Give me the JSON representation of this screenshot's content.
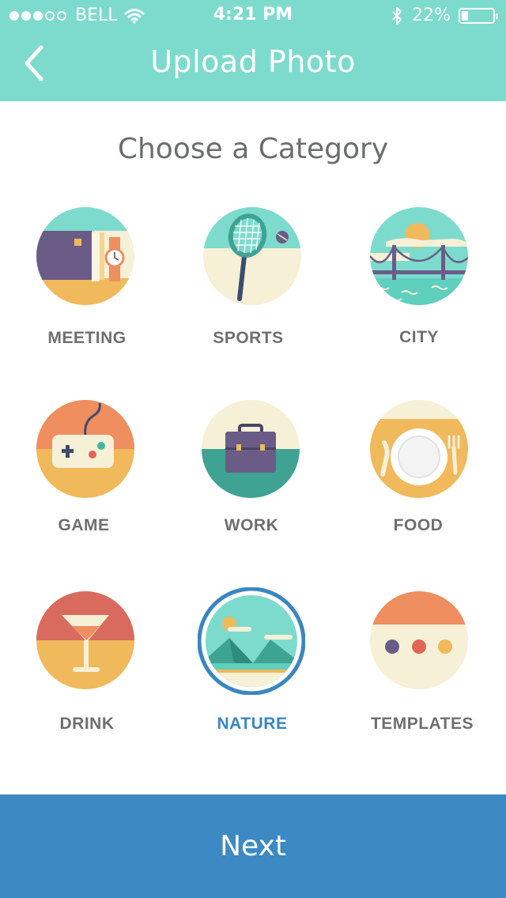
{
  "status_bar": {
    "carrier": "BELL",
    "time": "4:21 PM",
    "battery_percent": "22%",
    "battery_level": 0.22,
    "signal_bars": 3,
    "signal_total": 5,
    "icons": [
      "signal-dots-icon",
      "wifi-icon",
      "bluetooth-icon",
      "battery-icon"
    ]
  },
  "nav": {
    "title": "Upload Photo",
    "back_icon": "chevron-left-icon"
  },
  "heading": "Choose a Category",
  "categories": [
    {
      "label": "MEETING",
      "icon": "meeting-icon",
      "selected": false
    },
    {
      "label": "SPORTS",
      "icon": "tennis-racket-icon",
      "selected": false
    },
    {
      "label": "CITY",
      "icon": "bridge-icon",
      "selected": false
    },
    {
      "label": "GAME",
      "icon": "game-controller-icon",
      "selected": false
    },
    {
      "label": "WORK",
      "icon": "briefcase-icon",
      "selected": false
    },
    {
      "label": "FOOD",
      "icon": "plate-icon",
      "selected": false
    },
    {
      "label": "DRINK",
      "icon": "cocktail-icon",
      "selected": false
    },
    {
      "label": "NATURE",
      "icon": "mountains-icon",
      "selected": true
    },
    {
      "label": "TEMPLATES",
      "icon": "templates-icon",
      "selected": false
    }
  ],
  "colors": {
    "header": "#7ddbcd",
    "accent": "#3d89c3",
    "label": "#6c706f",
    "selected_label": "#3a86c1"
  },
  "footer": {
    "next_label": "Next"
  }
}
